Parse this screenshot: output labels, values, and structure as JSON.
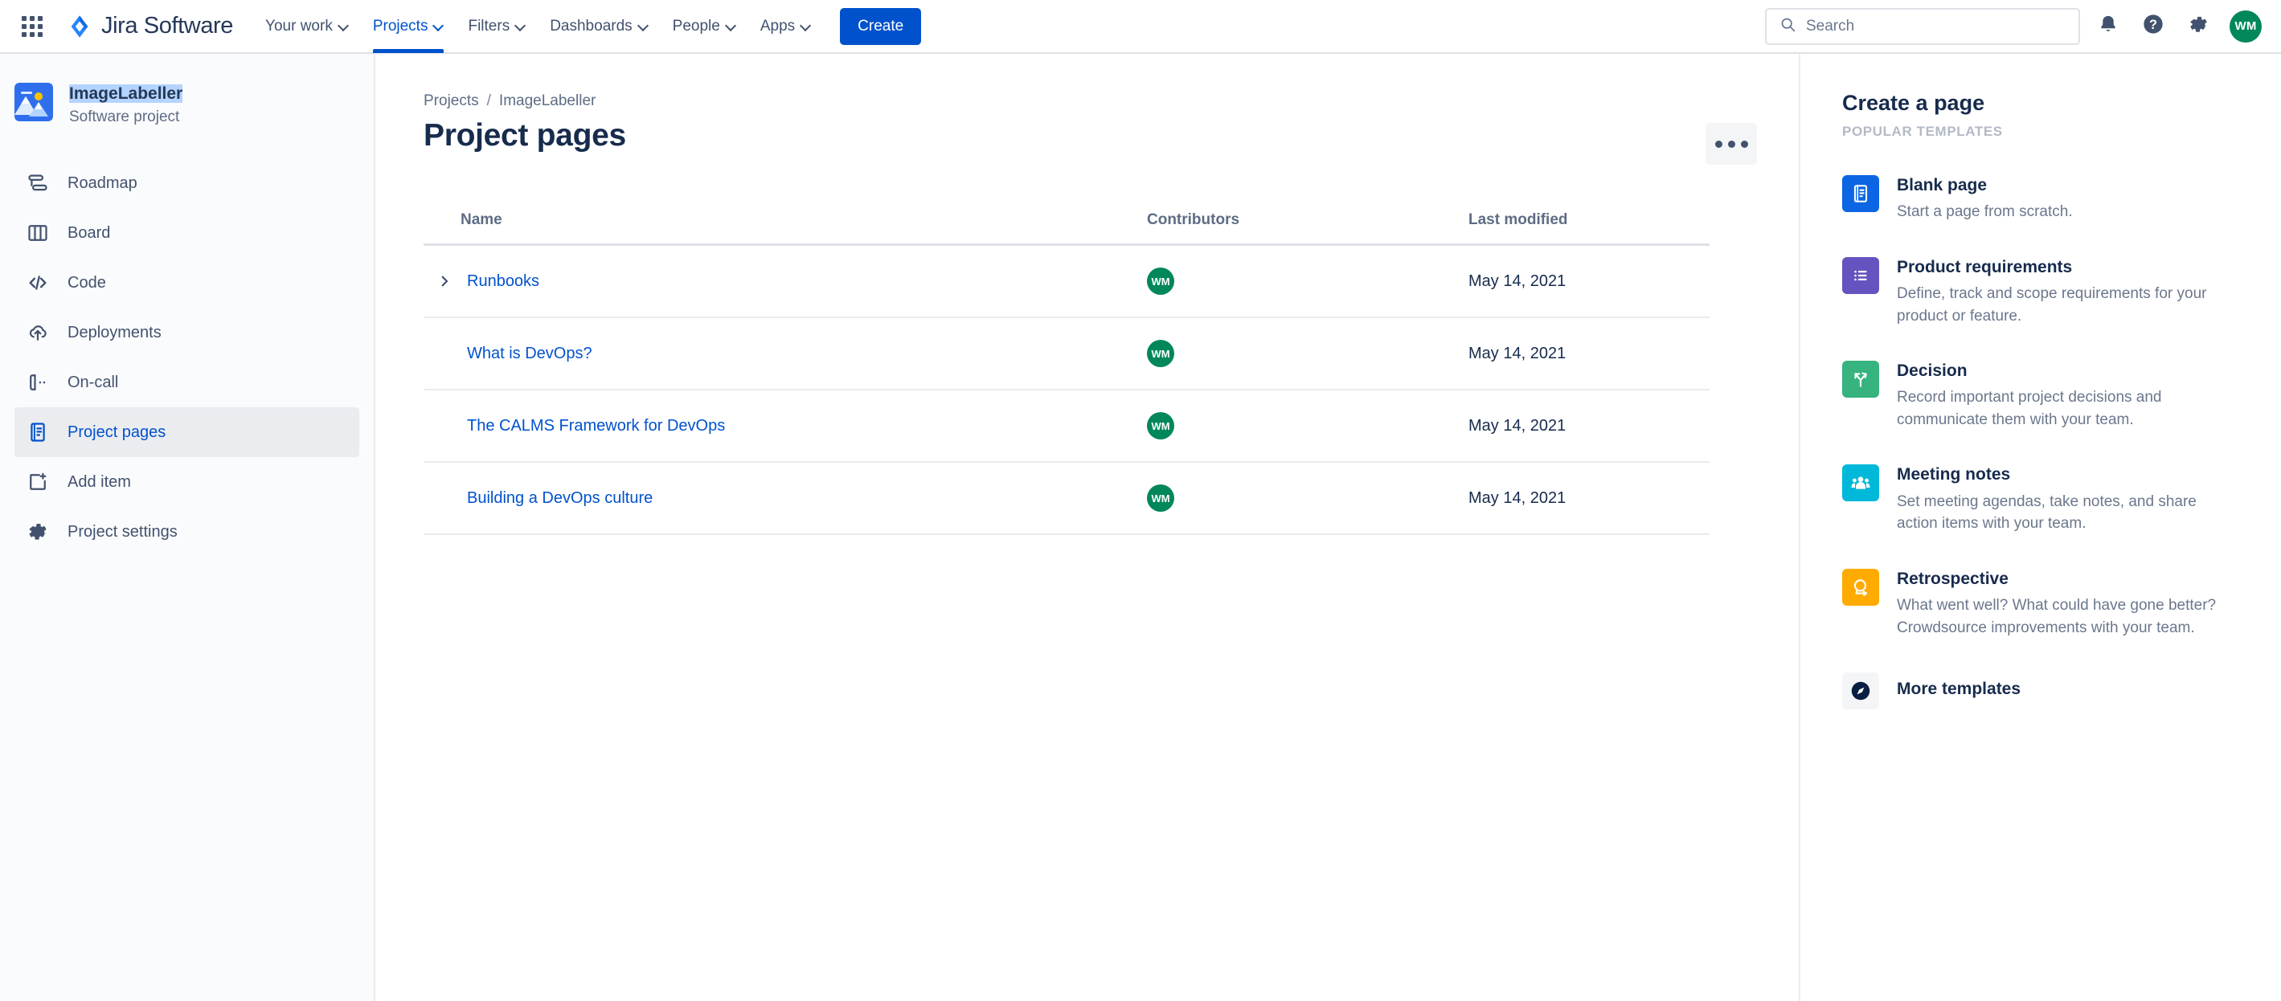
{
  "topnav": {
    "apps_icon": "apps-grid-icon",
    "brand": "Jira Software",
    "brand_icon": "jira-logo-icon",
    "items": [
      {
        "label": "Your work",
        "active": false
      },
      {
        "label": "Projects",
        "active": true
      },
      {
        "label": "Filters",
        "active": false
      },
      {
        "label": "Dashboards",
        "active": false
      },
      {
        "label": "People",
        "active": false
      },
      {
        "label": "Apps",
        "active": false
      }
    ],
    "create_label": "Create",
    "search_placeholder": "Search",
    "search_value": "",
    "notifications_icon": "notification-bell-icon",
    "help_icon": "help-question-icon",
    "settings_icon": "gear-icon",
    "account_initials": "WM"
  },
  "sidebar": {
    "project_name": "ImageLabeller",
    "project_type": "Software project",
    "project_icon": "image-mountain-icon",
    "items": [
      {
        "label": "Roadmap",
        "icon": "roadmap-icon",
        "active": false
      },
      {
        "label": "Board",
        "icon": "board-columns-icon",
        "active": false
      },
      {
        "label": "Code",
        "icon": "code-brackets-icon",
        "active": false
      },
      {
        "label": "Deployments",
        "icon": "deployments-cloud-icon",
        "active": false
      },
      {
        "label": "On-call",
        "icon": "on-call-phone-icon",
        "active": false
      },
      {
        "label": "Project pages",
        "icon": "page-document-icon",
        "active": true
      },
      {
        "label": "Add item",
        "icon": "add-item-plus-icon",
        "active": false
      },
      {
        "label": "Project settings",
        "icon": "gear-icon",
        "active": false
      }
    ]
  },
  "main": {
    "breadcrumb": {
      "root": "Projects",
      "separator": "/",
      "current": "ImageLabeller"
    },
    "title": "Project pages",
    "more_actions_icon": "more-ellipsis-icon",
    "table": {
      "headers": {
        "name": "Name",
        "contributors": "Contributors",
        "modified": "Last modified"
      },
      "rows": [
        {
          "name": "Runbooks",
          "expandable": true,
          "contributor": "WM",
          "modified": "May 14, 2021"
        },
        {
          "name": "What is DevOps?",
          "expandable": false,
          "contributor": "WM",
          "modified": "May 14, 2021"
        },
        {
          "name": "The CALMS Framework for DevOps",
          "expandable": false,
          "contributor": "WM",
          "modified": "May 14, 2021"
        },
        {
          "name": "Building a DevOps culture",
          "expandable": false,
          "contributor": "WM",
          "modified": "May 14, 2021"
        }
      ]
    }
  },
  "rightpanel": {
    "title": "Create a page",
    "subtitle": "POPULAR TEMPLATES",
    "templates": [
      {
        "name": "Blank page",
        "desc": "Start a page from scratch.",
        "icon": "blank-page-icon",
        "color": "#0c66e4"
      },
      {
        "name": "Product requirements",
        "desc": "Define, track and scope requirements for your product or feature.",
        "icon": "requirements-list-icon",
        "color": "#6554c0"
      },
      {
        "name": "Decision",
        "desc": "Record important project decisions and communicate them with your team.",
        "icon": "decision-fork-icon",
        "color": "#36b37e"
      },
      {
        "name": "Meeting notes",
        "desc": "Set meeting agendas, take notes, and share action items with your team.",
        "icon": "meeting-people-icon",
        "color": "#00b8d9"
      },
      {
        "name": "Retrospective",
        "desc": "What went well? What could have gone better? Crowdsource improvements with your team.",
        "icon": "retrospective-loop-icon",
        "color": "#ffab00"
      },
      {
        "name": "More templates",
        "desc": "",
        "icon": "compass-icon",
        "color": "#f4f5f7"
      }
    ]
  },
  "colors": {
    "brand_blue": "#0052cc",
    "link_blue": "#0052cc",
    "avatar_green": "#00875a",
    "text_dark": "#172b4d",
    "text_subtle": "#5e6c84",
    "selection_highlight": "#b3d4ff"
  }
}
